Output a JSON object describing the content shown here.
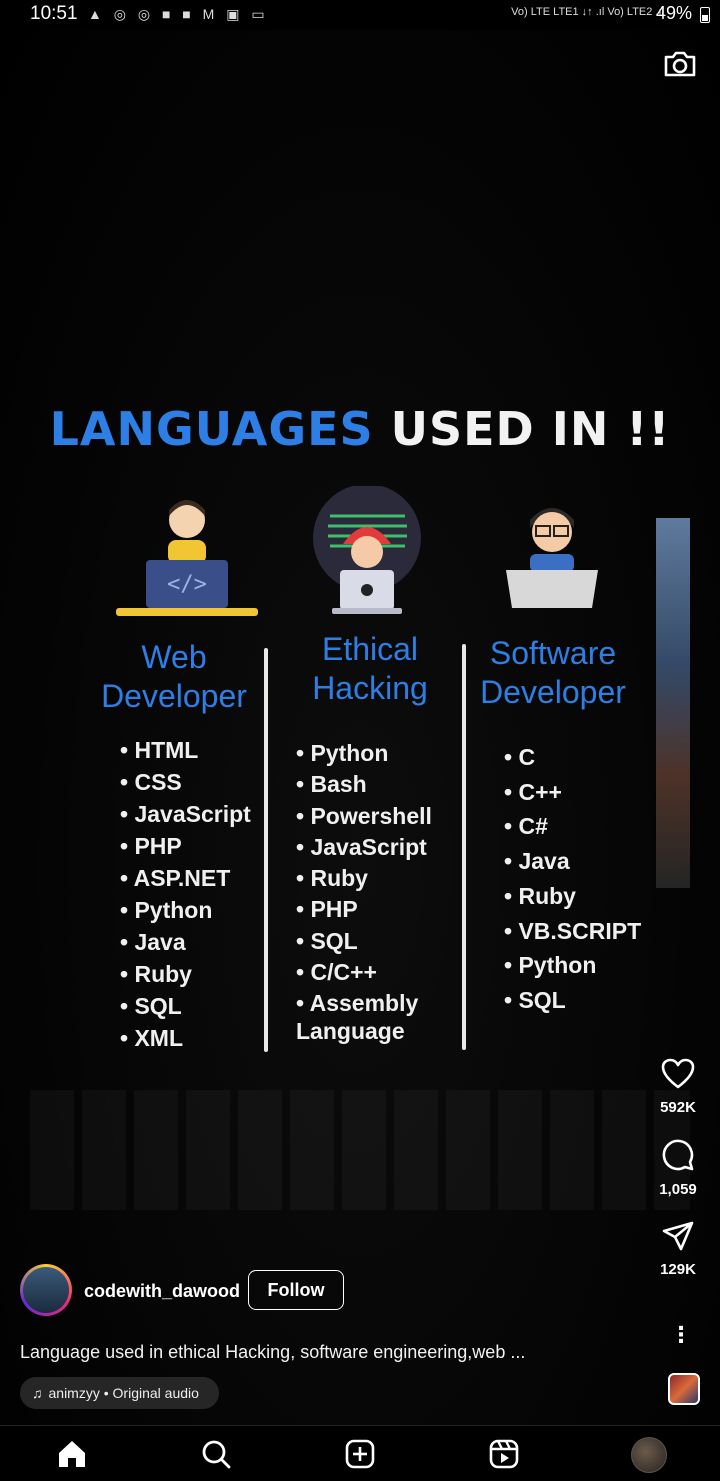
{
  "status_bar": {
    "time": "10:51",
    "notification_icons": "▲ ◎ ◎ ■ ■ M ▣ ▭",
    "network": "Vo) LTE LTE1 ↓↑ .ıl Vo) LTE2 .ıl",
    "battery": "49%"
  },
  "poster": {
    "title_blue": "LANGUAGES",
    "title_white": "USED IN !!",
    "columns": [
      {
        "heading_line1": "Web",
        "heading_line2": "Developer",
        "items": [
          "HTML",
          "CSS",
          "JavaScript",
          "PHP",
          "ASP.NET",
          "Python",
          "Java",
          "Ruby",
          "SQL",
          "XML"
        ]
      },
      {
        "heading_line1": "Ethical",
        "heading_line2": "Hacking",
        "items": [
          "Python",
          "Bash",
          "Powershell",
          "JavaScript",
          "Ruby",
          "PHP",
          "SQL",
          "C/C++",
          "Assembly"
        ],
        "trailing_text": "Language"
      },
      {
        "heading_line1": "Software",
        "heading_line2": "Developer",
        "items": [
          "C",
          "C++",
          "C#",
          "Java",
          "Ruby",
          "VB.SCRIPT",
          "Python",
          "SQL"
        ]
      }
    ],
    "accent_color": "#2d7fe6"
  },
  "actions": {
    "likes": "592K",
    "comments": "1,059",
    "shares": "129K"
  },
  "author": {
    "username": "codewith_dawood",
    "follow_label": "Follow"
  },
  "caption": "Language used in ethical Hacking, software engineering,web ...",
  "audio": {
    "label": "animzyy • Original audio"
  },
  "more_label": "⋮"
}
